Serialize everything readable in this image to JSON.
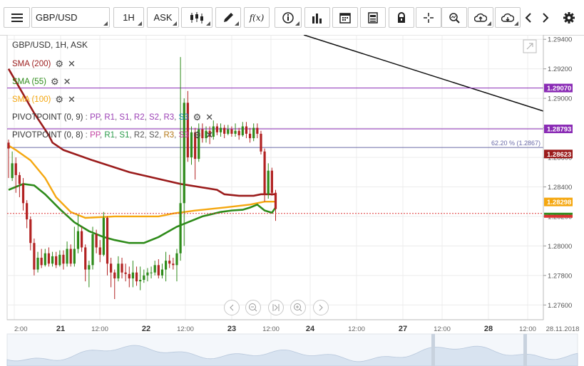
{
  "toolbar": {
    "symbol": "GBP/USD",
    "interval": "1H",
    "price_type": "ASK",
    "function_label": "f(x)"
  },
  "chart_data": {
    "type": "candlestick",
    "title": "GBP/USD, 1H, ASK",
    "ylim": [
      1.275,
      1.2943
    ],
    "yticks": [
      "1.29400",
      "1.29200",
      "1.29000",
      "1.28800",
      "1.28600",
      "1.28400",
      "1.28200",
      "1.28000",
      "1.27800",
      "1.27600"
    ],
    "xticks": [
      "2:00",
      "21",
      "12:00",
      "22",
      "12:00",
      "23",
      "12:00",
      "24",
      "12:00",
      "27",
      "12:00",
      "28",
      "12:00",
      "28.11.2018"
    ],
    "legend": [
      {
        "label": "SMA (200)",
        "color": "#9b1c1c"
      },
      {
        "label": "SMA (55)",
        "color": "#2e8b1a"
      },
      {
        "label": "SMA (100)",
        "color": "#f5a70f"
      },
      {
        "label": "PIVOTPOINT (0, 9)",
        "color": "#333333",
        "keys": [
          {
            "t": "PP",
            "c": "#9b3fb5"
          },
          {
            "t": "R1",
            "c": "#9b3fb5"
          },
          {
            "t": "S1",
            "c": "#9b3fb5"
          },
          {
            "t": "R2",
            "c": "#9b3fb5"
          },
          {
            "t": "S2",
            "c": "#9b3fb5"
          },
          {
            "t": "R3",
            "c": "#9b3fb5"
          },
          {
            "t": "S3",
            "c": "#1a8fb5"
          }
        ]
      },
      {
        "label": "PIVOTPOINT (0, 8)",
        "color": "#333333",
        "keys": [
          {
            "t": "PP",
            "c": "#c23fa0"
          },
          {
            "t": "R1",
            "c": "#2a9a4a"
          },
          {
            "t": "S1",
            "c": "#2a9a4a"
          },
          {
            "t": "R2",
            "c": "#555555"
          },
          {
            "t": "S2",
            "c": "#555555"
          },
          {
            "t": "R3",
            "c": "#b57a1a"
          },
          {
            "t": "S3",
            "c": "#c23fa0"
          }
        ]
      }
    ],
    "hlines": [
      {
        "value": 1.2907,
        "color": "#8a2bb5",
        "label": "1.29070"
      },
      {
        "value": 1.28793,
        "color": "#8a2bb5",
        "label": "1.28793"
      },
      {
        "value": 1.28667,
        "color": "#6a6aa8",
        "label": "62.20 % (1.2867)"
      }
    ],
    "badges": [
      {
        "value": 1.2907,
        "label": "1.29070",
        "bg": "#8a2bb5"
      },
      {
        "value": 1.28793,
        "label": "1.28793",
        "bg": "#8a2bb5"
      },
      {
        "value": 1.28623,
        "label": "1.28623",
        "bg": "#9b1c1c"
      },
      {
        "value": 1.28298,
        "label": "1.28298",
        "bg": "#f5a70f"
      }
    ],
    "trendline": [
      [
        1.295,
        -40
      ],
      [
        1.2888,
        759
      ]
    ],
    "candles": [
      [
        1.287,
        1.2866,
        1.2872,
        1.2846
      ],
      [
        1.2846,
        1.2856,
        1.2864,
        1.2844
      ],
      [
        1.2856,
        1.2848,
        1.286,
        1.2836
      ],
      [
        1.2848,
        1.2842,
        1.285,
        1.2833
      ],
      [
        1.2842,
        1.2829,
        1.2846,
        1.2824
      ],
      [
        1.2829,
        1.2818,
        1.2831,
        1.2812
      ],
      [
        1.2818,
        1.2802,
        1.282,
        1.2797
      ],
      [
        1.2802,
        1.2784,
        1.2805,
        1.278
      ],
      [
        1.2784,
        1.2792,
        1.2796,
        1.2782
      ],
      [
        1.2792,
        1.2787,
        1.2798,
        1.2785
      ],
      [
        1.2787,
        1.2795,
        1.2798,
        1.2786
      ],
      [
        1.2795,
        1.2788,
        1.2799,
        1.2786
      ],
      [
        1.2788,
        1.2793,
        1.2796,
        1.2786
      ],
      [
        1.2793,
        1.2787,
        1.2796,
        1.2785
      ],
      [
        1.2787,
        1.2794,
        1.2797,
        1.2786
      ],
      [
        1.2794,
        1.2788,
        1.2797,
        1.2784
      ],
      [
        1.2788,
        1.2798,
        1.2803,
        1.2786
      ],
      [
        1.2798,
        1.2788,
        1.2801,
        1.2786
      ],
      [
        1.2788,
        1.2798,
        1.2813,
        1.2786
      ],
      [
        1.2798,
        1.281,
        1.2821,
        1.2795
      ],
      [
        1.281,
        1.2799,
        1.2813,
        1.2796
      ],
      [
        1.2799,
        1.2784,
        1.2801,
        1.2776
      ],
      [
        1.2784,
        1.2787,
        1.279,
        1.2772
      ],
      [
        1.2787,
        1.2808,
        1.2813,
        1.2784
      ],
      [
        1.2808,
        1.2799,
        1.2811,
        1.2795
      ],
      [
        1.2799,
        1.2794,
        1.2804,
        1.2789
      ],
      [
        1.2794,
        1.2819,
        1.2823,
        1.2793
      ],
      [
        1.2819,
        1.2788,
        1.282,
        1.278
      ],
      [
        1.2788,
        1.2782,
        1.2792,
        1.2772
      ],
      [
        1.2782,
        1.2778,
        1.2784,
        1.2764
      ],
      [
        1.2778,
        1.2788,
        1.2793,
        1.2776
      ],
      [
        1.2788,
        1.2782,
        1.2792,
        1.2778
      ],
      [
        1.2782,
        1.2781,
        1.2788,
        1.2776
      ],
      [
        1.2781,
        1.2778,
        1.2786,
        1.2772
      ],
      [
        1.2778,
        1.2782,
        1.279,
        1.2772
      ],
      [
        1.2782,
        1.2776,
        1.2786,
        1.2773
      ],
      [
        1.2776,
        1.2777,
        1.2786,
        1.277
      ],
      [
        1.2777,
        1.278,
        1.2784,
        1.2775
      ],
      [
        1.278,
        1.2782,
        1.2785,
        1.2776
      ],
      [
        1.2782,
        1.2782,
        1.2786,
        1.2778
      ],
      [
        1.2782,
        1.2787,
        1.279,
        1.278
      ],
      [
        1.2787,
        1.278,
        1.2791,
        1.2778
      ],
      [
        1.278,
        1.2784,
        1.2788,
        1.2778
      ],
      [
        1.2784,
        1.279,
        1.2796,
        1.2776
      ],
      [
        1.279,
        1.2788,
        1.2794,
        1.2785
      ],
      [
        1.2788,
        1.2787,
        1.2792,
        1.2784
      ],
      [
        1.2787,
        1.2795,
        1.2798,
        1.2776
      ],
      [
        1.2795,
        1.2829,
        1.2928,
        1.279
      ],
      [
        1.2829,
        1.2897,
        1.29,
        1.28
      ],
      [
        1.2897,
        1.286,
        1.2905,
        1.2857
      ],
      [
        1.286,
        1.2877,
        1.2881,
        1.2855
      ],
      [
        1.2877,
        1.2859,
        1.288,
        1.2845
      ],
      [
        1.2859,
        1.2879,
        1.2883,
        1.2857
      ],
      [
        1.2879,
        1.2873,
        1.2883,
        1.287
      ],
      [
        1.2873,
        1.2878,
        1.2881,
        1.287
      ],
      [
        1.2878,
        1.2874,
        1.2881,
        1.2869
      ],
      [
        1.2874,
        1.2881,
        1.2885,
        1.2872
      ],
      [
        1.2881,
        1.2877,
        1.2883,
        1.2875
      ],
      [
        1.2877,
        1.288,
        1.2883,
        1.2874
      ],
      [
        1.288,
        1.2876,
        1.2882,
        1.2873
      ],
      [
        1.2876,
        1.2879,
        1.2882,
        1.2875
      ],
      [
        1.2879,
        1.2876,
        1.2881,
        1.2874
      ],
      [
        1.2876,
        1.2878,
        1.2883,
        1.2874
      ],
      [
        1.2878,
        1.2875,
        1.288,
        1.2872
      ],
      [
        1.2875,
        1.2881,
        1.2884,
        1.2874
      ],
      [
        1.2881,
        1.2876,
        1.2884,
        1.2873
      ],
      [
        1.2876,
        1.2873,
        1.288,
        1.287
      ],
      [
        1.2873,
        1.288,
        1.2883,
        1.2871
      ],
      [
        1.288,
        1.2876,
        1.2883,
        1.2873
      ],
      [
        1.2876,
        1.2864,
        1.2878,
        1.2862
      ],
      [
        1.2864,
        1.2835,
        1.2866,
        1.283
      ],
      [
        1.2835,
        1.2851,
        1.2856,
        1.2832
      ],
      [
        1.2851,
        1.2836,
        1.2853,
        1.2834
      ],
      [
        1.2836,
        1.2825,
        1.2838,
        1.2817
      ]
    ],
    "sma200": [
      [
        1.292,
        0
      ],
      [
        1.289,
        7
      ],
      [
        1.2875,
        11
      ],
      [
        1.287,
        12
      ],
      [
        1.2865,
        15
      ],
      [
        1.2858,
        23
      ],
      [
        1.285,
        33
      ],
      [
        1.2842,
        47
      ],
      [
        1.2838,
        57
      ],
      [
        1.2835,
        59
      ],
      [
        1.2834,
        63
      ],
      [
        1.2834,
        67
      ],
      [
        1.2835,
        69
      ],
      [
        1.2835,
        73
      ]
    ],
    "sma55": [
      [
        1.2838,
        0
      ],
      [
        1.2842,
        4
      ],
      [
        1.2841,
        7
      ],
      [
        1.2835,
        10
      ],
      [
        1.2825,
        14
      ],
      [
        1.2816,
        18
      ],
      [
        1.281,
        22
      ],
      [
        1.2806,
        26
      ],
      [
        1.2804,
        29
      ],
      [
        1.2802,
        33
      ],
      [
        1.2802,
        37
      ],
      [
        1.2806,
        41
      ],
      [
        1.2813,
        46
      ],
      [
        1.282,
        53
      ],
      [
        1.2823,
        58
      ],
      [
        1.2824,
        61
      ],
      [
        1.28245,
        64
      ],
      [
        1.2826,
        66
      ],
      [
        1.2828,
        68
      ],
      [
        1.2824,
        70
      ],
      [
        1.28225,
        72
      ],
      [
        1.2826,
        73
      ]
    ],
    "sma100": [
      [
        1.2868,
        0
      ],
      [
        1.2865,
        2
      ],
      [
        1.2858,
        6
      ],
      [
        1.2846,
        10
      ],
      [
        1.2833,
        13
      ],
      [
        1.2823,
        17
      ],
      [
        1.2819,
        21
      ],
      [
        1.282,
        29
      ],
      [
        1.282,
        37
      ],
      [
        1.282,
        41
      ],
      [
        1.2822,
        45
      ],
      [
        1.2824,
        51
      ],
      [
        1.2826,
        59
      ],
      [
        1.2828,
        66
      ],
      [
        1.283,
        70
      ],
      [
        1.283,
        73
      ]
    ],
    "current_price": 1.2822
  }
}
